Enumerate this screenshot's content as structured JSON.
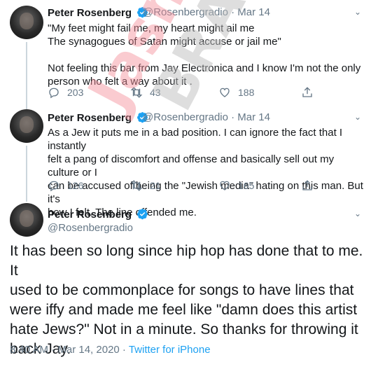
{
  "tweets": [
    {
      "name": "Peter Rosenberg",
      "handle": "@Rosenbergradio",
      "date": "· Mar 14",
      "text_lines": [
        "\"My feet might fail me, my heart might ail me",
        "The synagogues of Satan might accuse or jail me\"",
        "",
        "Not feeling this bar from Jay Electronica and I know I'm not the only",
        "person who felt a way about it ."
      ],
      "replies": "203",
      "retweets": "43",
      "likes": "188"
    },
    {
      "name": "Peter Rosenberg",
      "handle": "@Rosenbergradio",
      "date": "· Mar 14",
      "text_lines": [
        "As a Jew it puts me in a bad position. I can ignore the fact that I instantly",
        "felt a pang of discomfort and offense and basically sell out my culture or I",
        "can be accused of being the \"Jewish media\" hating on this man. But it's",
        "how I felt. The line offended me."
      ],
      "replies": "126",
      "retweets": "21",
      "likes": "165"
    }
  ],
  "main_tweet": {
    "name": "Peter Rosenberg",
    "handle": "@Rosenbergradio",
    "text_lines": [
      "It has been so long since hip hop has done that to me. It",
      "used to be commonplace for songs to have lines that",
      "were iffy and made me feel like \"damn does this artist",
      "hate Jews?\" Not in a minute. So thanks for throwing it",
      "back Jay."
    ],
    "timestamp": "8:40 AM · Mar 14, 2020 · ",
    "source": "Twitter for iPhone"
  },
  "watermark": {
    "line1": "the",
    "line2": "Jasmine",
    "line3": "BRAND"
  },
  "colors": {
    "verified": "#1da1f2",
    "muted": "#657786",
    "link": "#1da1f2",
    "watermark_pink": "#f4b0b6",
    "watermark_gray": "#c9c9c9"
  }
}
